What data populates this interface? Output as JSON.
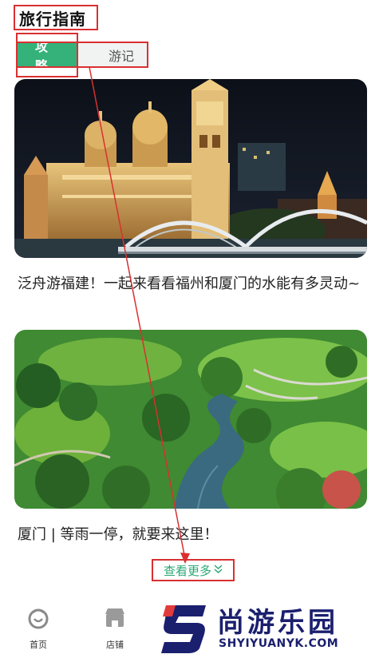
{
  "header": {
    "title": "旅行指南"
  },
  "tabs": [
    {
      "label": "攻略",
      "active": true
    },
    {
      "label": "游记",
      "active": false
    }
  ],
  "cards": [
    {
      "image": "fuzhou-night-cathedral-bridge",
      "caption": "泛舟游福建！一起来看看福州和厦门的水能有多灵动~"
    },
    {
      "image": "xiamen-park-aerial-river",
      "caption": "厦门 | 等雨一停，就要来这里！"
    }
  ],
  "more": {
    "label": "查看更多",
    "icon": "double-chevron-down-icon"
  },
  "bottom_nav": [
    {
      "label": "首页",
      "icon": "home-icon"
    },
    {
      "label": "店铺",
      "icon": "store-icon"
    }
  ],
  "watermark": {
    "title": "尚游乐园",
    "subtitle": "SHYIYUANYK.COM"
  },
  "colors": {
    "accent": "#34b27a",
    "annotation": "#d93030",
    "link": "#2aa876",
    "watermark": "#1a1f6e"
  }
}
